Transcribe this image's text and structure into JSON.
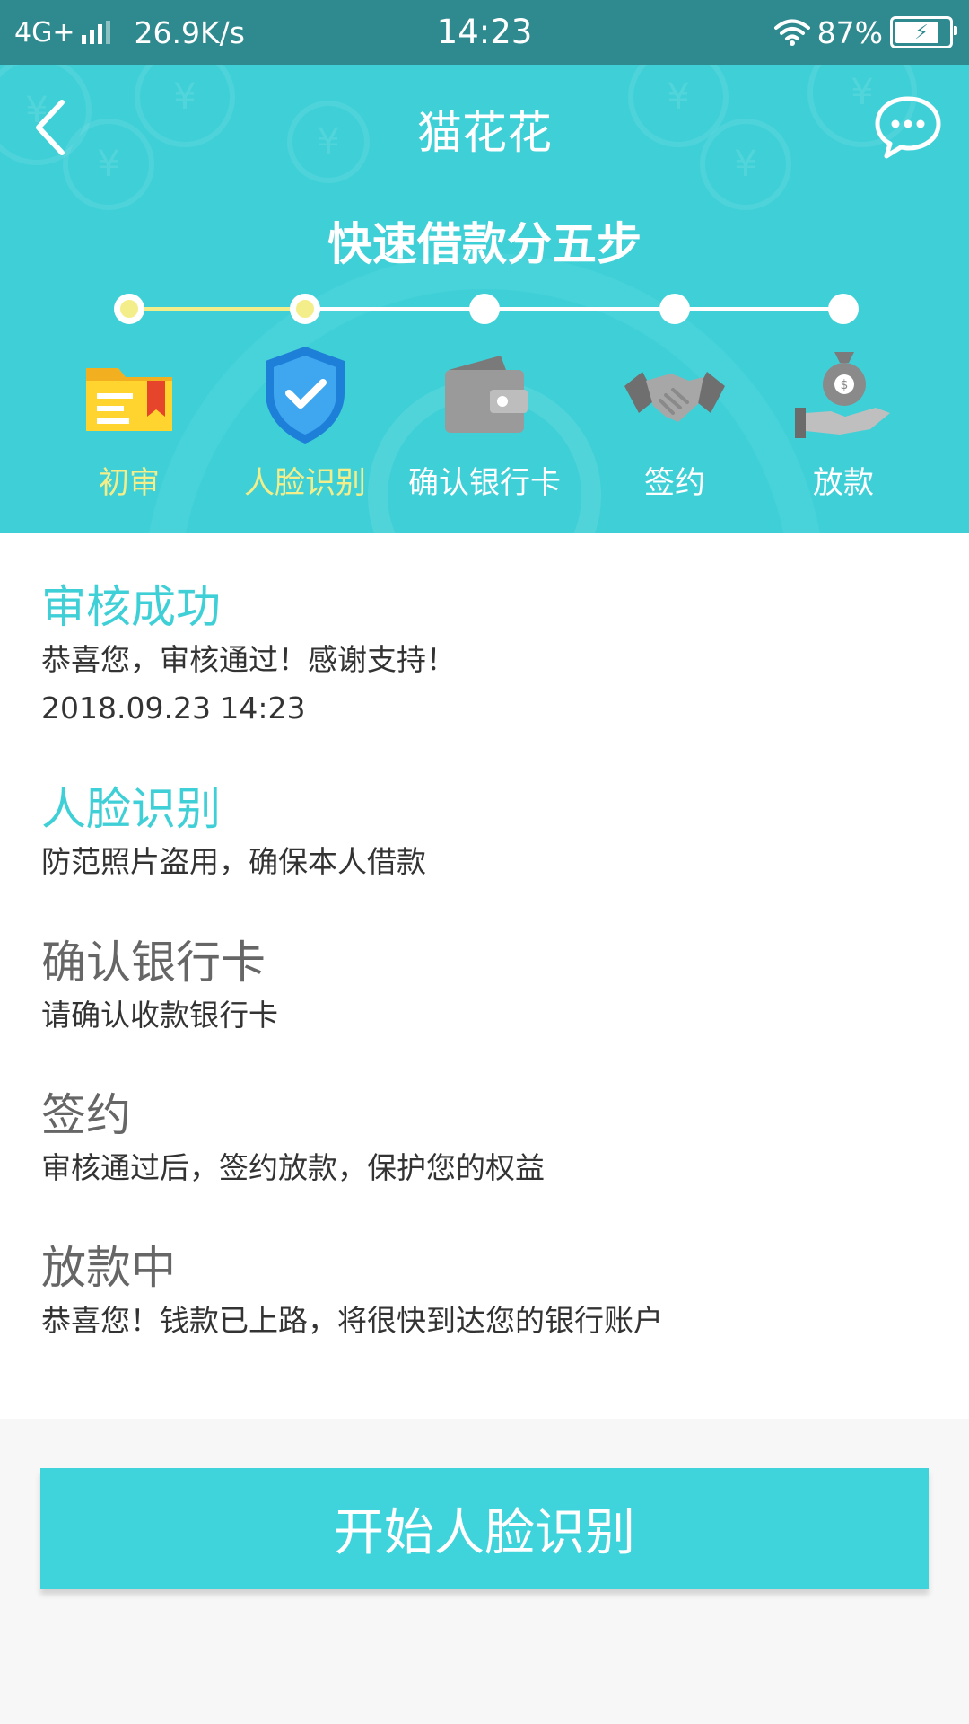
{
  "status_bar": {
    "network": "4G+",
    "speed": "26.9K/s",
    "time": "14:23",
    "battery": "87%",
    "icons": [
      "signal-icon",
      "wifi-icon",
      "battery-icon"
    ]
  },
  "nav": {
    "title": "猫花花",
    "back_icon": "back-arrow-icon",
    "chat_icon": "chat-bubble-icon"
  },
  "steps": {
    "title": "快速借款分五步",
    "items": [
      {
        "label": "初审",
        "icon": "folder-icon",
        "done": true
      },
      {
        "label": "人脸识别",
        "icon": "shield-check-icon",
        "done": true
      },
      {
        "label": "确认银行卡",
        "icon": "wallet-icon",
        "done": false
      },
      {
        "label": "签约",
        "icon": "handshake-icon",
        "done": false
      },
      {
        "label": "放款",
        "icon": "money-bag-hand-icon",
        "done": false
      }
    ]
  },
  "sections": [
    {
      "title": "审核成功",
      "lines": [
        "恭喜您，审核通过！感谢支持！",
        "2018.09.23  14:23"
      ],
      "active": true
    },
    {
      "title": "人脸识别",
      "lines": [
        "防范照片盗用，确保本人借款"
      ],
      "active": true
    },
    {
      "title": "确认银行卡",
      "lines": [
        "请确认收款银行卡"
      ],
      "active": false
    },
    {
      "title": "签约",
      "lines": [
        "审核通过后，签约放款，保护您的权益"
      ],
      "active": false
    },
    {
      "title": "放款中",
      "lines": [
        "恭喜您！钱款已上路，将很快到达您的银行账户"
      ],
      "active": false
    }
  ],
  "cta": {
    "label": "开始人脸识别"
  },
  "colors": {
    "accent": "#3fd0d7",
    "status_bar": "#2f8a8f",
    "done": "#f4ee8a",
    "section_active": "#3fcfd6",
    "section_inactive": "#666666"
  }
}
